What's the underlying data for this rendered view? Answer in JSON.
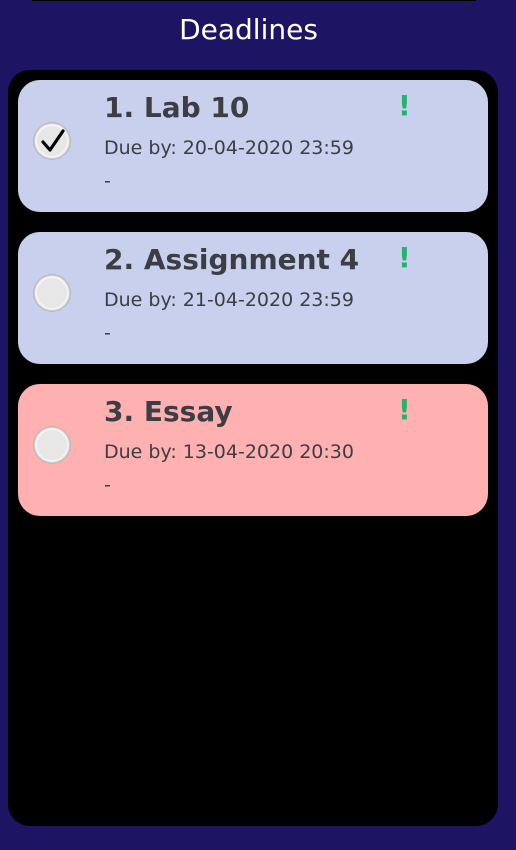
{
  "header": {
    "title": "Deadlines"
  },
  "colors": {
    "background": "#1e1464",
    "list_background": "#000000",
    "card_normal": "#c8d0ed",
    "card_overdue": "#ffb1b1",
    "priority": "#25b26d",
    "text": "#3c3e44"
  },
  "deadlines": [
    {
      "title": "1. Lab 10",
      "due": "Due by: 20-04-2020 23:59",
      "description": "-",
      "priority": "!",
      "checked": true,
      "status": "normal"
    },
    {
      "title": "2. Assignment 4",
      "due": "Due by: 21-04-2020 23:59",
      "description": "-",
      "priority": "!",
      "checked": false,
      "status": "normal"
    },
    {
      "title": "3. Essay",
      "due": "Due by: 13-04-2020 20:30",
      "description": "-",
      "priority": "!",
      "checked": false,
      "status": "overdue"
    }
  ]
}
